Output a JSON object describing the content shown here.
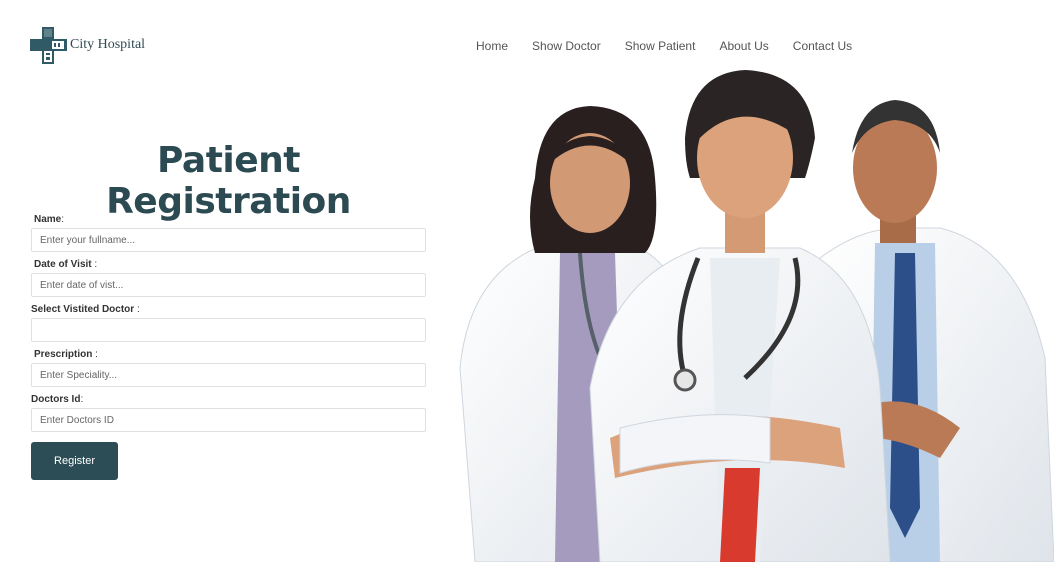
{
  "brand": {
    "name": "City Hospital",
    "icon": "hospital-cross-icon",
    "color": "#2c4d55"
  },
  "nav": [
    {
      "label": "Home"
    },
    {
      "label": "Show Doctor"
    },
    {
      "label": "Show Patient"
    },
    {
      "label": "About Us"
    },
    {
      "label": "Contact Us"
    }
  ],
  "page": {
    "title": "Patient Registration"
  },
  "form": {
    "fields": [
      {
        "label": "Name",
        "colon": ":",
        "placeholder": "Enter your fullname..."
      },
      {
        "label": "Date of Visit",
        "colon": " :",
        "placeholder": "Enter date of vist..."
      },
      {
        "label": "Select Vistited Doctor",
        "colon": " :",
        "placeholder": ""
      },
      {
        "label": "Prescription",
        "colon": " :",
        "placeholder": "Enter Speciality..."
      },
      {
        "label": "Doctors Id",
        "colon": ":",
        "placeholder": "Enter Doctors ID"
      }
    ],
    "submit_label": "Register"
  },
  "hero": {
    "alt": "Three doctors in white coats with stethoscopes"
  }
}
